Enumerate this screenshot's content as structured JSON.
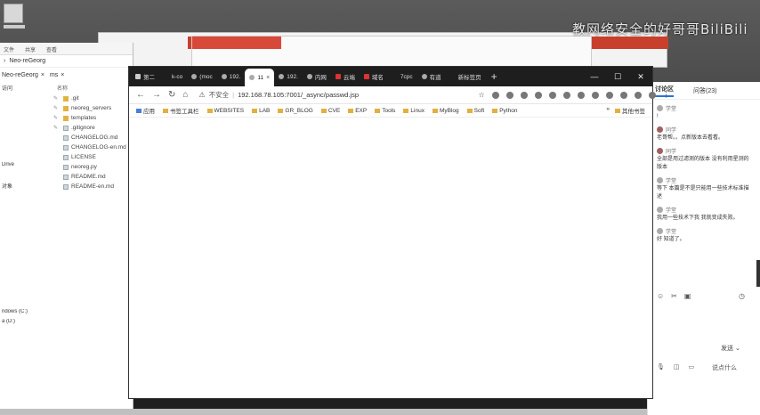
{
  "watermark": "教网络安全的好哥哥BiliBili",
  "explorer": {
    "ribbon": [
      "文件",
      "共享",
      "查看"
    ],
    "crumb": "Neo-reGeorg",
    "tabs": [
      "Neo-reGeorg",
      "×",
      "ms",
      "×"
    ],
    "column_header": "名称",
    "nav": [
      "访问",
      "",
      "",
      "",
      "",
      "",
      "",
      "",
      "Drive",
      "",
      "对象",
      "",
      "",
      "",
      "",
      "",
      "",
      "",
      "",
      "",
      "",
      "",
      "",
      "ndows (C:)",
      "a (D:)"
    ],
    "files": [
      {
        "name": ".git",
        "type": "folder"
      },
      {
        "name": "neoreg_servers",
        "type": "folder"
      },
      {
        "name": "templates",
        "type": "folder"
      },
      {
        "name": ".gitignore",
        "type": "file"
      },
      {
        "name": "CHANGELOG.md",
        "type": "file"
      },
      {
        "name": "CHANGELOG-en.md",
        "type": "file"
      },
      {
        "name": "LICENSE",
        "type": "file"
      },
      {
        "name": "neoreg.py",
        "type": "file"
      },
      {
        "name": "README.md",
        "type": "file"
      },
      {
        "name": "README-en.md",
        "type": "file"
      }
    ]
  },
  "browser": {
    "tabs": [
      {
        "label": "第二",
        "icon": "doc",
        "active": false
      },
      {
        "label": "k-co",
        "icon": "none",
        "active": false
      },
      {
        "label": "(moc",
        "icon": "spinner",
        "active": false
      },
      {
        "label": "192.",
        "icon": "globe",
        "active": false
      },
      {
        "label": "11",
        "icon": "globe",
        "active": true,
        "close": "×"
      },
      {
        "label": "192.",
        "icon": "globe",
        "active": false
      },
      {
        "label": "内网",
        "icon": "code",
        "active": false
      },
      {
        "label": "云端",
        "icon": "red",
        "active": false
      },
      {
        "label": "域名",
        "icon": "red",
        "active": false
      },
      {
        "label": "7cpc",
        "icon": "none",
        "active": false
      },
      {
        "label": "有道",
        "icon": "globe",
        "active": false
      },
      {
        "label": "新标签页",
        "icon": "none",
        "active": false
      }
    ],
    "new_tab": "+",
    "window_controls": [
      "—",
      "☐",
      "✕"
    ],
    "nav_buttons": [
      "←",
      "→",
      "↻",
      "⌂"
    ],
    "security_label": "不安全",
    "url": "192.168.78.105:7001/_async/passwd.jsp",
    "bookmarks": [
      "应用",
      "书签工具栏",
      "WEBSITES",
      "LAB",
      "GR_BLOG",
      "CVE",
      "EXP",
      "Tools",
      "Linux",
      "MyBlog",
      "Soft",
      "Python"
    ],
    "bookmarks_other": "其他书签"
  },
  "chat": {
    "tabs": [
      "讨论区",
      "问答(23)"
    ],
    "messages": [
      {
        "user": "学堂",
        "text": "!"
      },
      {
        "user": "同学",
        "text": "老哥帮。。点新版本去看看。"
      },
      {
        "user": "同学",
        "text": "全部是用过滤测的版本 没有利用星测的版本"
      },
      {
        "user": "学堂",
        "text": "等下 本篇是不是只能用一些技术标准描述"
      },
      {
        "user": "学堂",
        "text": "我用一些技术下我 我就变成失败。"
      },
      {
        "user": "学堂",
        "text": "好 知道了。"
      }
    ],
    "send_label": "发送",
    "bottom_label": "说点什么"
  }
}
